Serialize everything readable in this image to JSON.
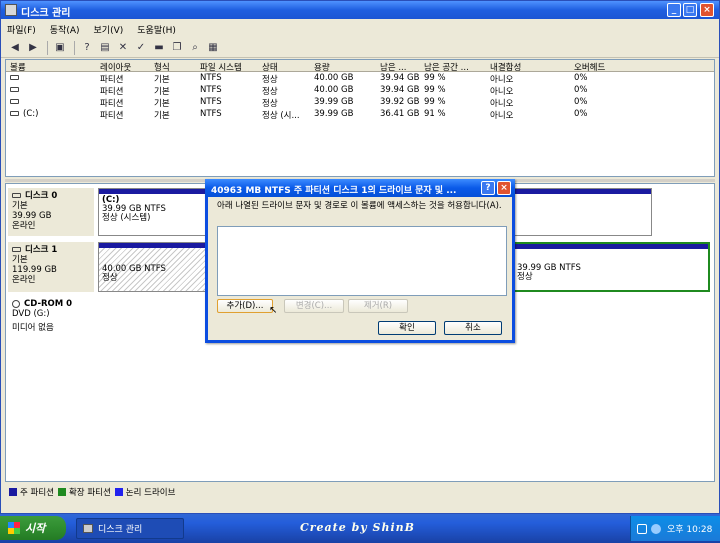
{
  "window": {
    "title": "디스크 관리",
    "min": "_",
    "max": "□",
    "close": "×"
  },
  "menu": [
    "파일(F)",
    "동작(A)",
    "보기(V)",
    "도움말(H)"
  ],
  "columns": [
    "볼륨",
    "레이아웃",
    "형식",
    "파일 시스템",
    "상태",
    "용량",
    "남은 ...",
    "남은 공간 ...",
    "내결함성",
    "오버헤드"
  ],
  "volumes": [
    [
      "",
      "파티션",
      "기본",
      "NTFS",
      "정상",
      "40.00 GB",
      "39.94 GB",
      "99 %",
      "아니오",
      "0%"
    ],
    [
      "",
      "파티션",
      "기본",
      "NTFS",
      "정상",
      "40.00 GB",
      "39.94 GB",
      "99 %",
      "아니오",
      "0%"
    ],
    [
      "",
      "파티션",
      "기본",
      "NTFS",
      "정상",
      "39.99 GB",
      "39.92 GB",
      "99 %",
      "아니오",
      "0%"
    ],
    [
      "(C:)",
      "파티션",
      "기본",
      "NTFS",
      "정상 (시...",
      "39.99 GB",
      "36.41 GB",
      "91 %",
      "아니오",
      "0%"
    ]
  ],
  "disks": {
    "disk0": {
      "name": "디스크 0",
      "type": "기본",
      "size": "39.99 GB",
      "status": "온라인",
      "part": {
        "letter": "(C:)",
        "fs": "39.99 GB NTFS",
        "state": "정상 (시스템)"
      }
    },
    "disk1": {
      "name": "디스크 1",
      "type": "기본",
      "size": "119.99 GB",
      "status": "온라인",
      "part1": {
        "fs": "40.00 GB NTFS",
        "state": "정상"
      },
      "part3": {
        "fs": "39.99 GB NTFS",
        "state": "정상"
      }
    },
    "cdrom": {
      "name": "CD-ROM 0",
      "type": "DVD (G:)",
      "media": "미디어 없음"
    }
  },
  "legend": [
    {
      "label": "주 파티션",
      "color": "#1a1aa0"
    },
    {
      "label": "확장 파티션",
      "color": "#1f8a1f"
    },
    {
      "label": "논리 드라이브",
      "color": "#2222ee"
    }
  ],
  "dialog": {
    "title": "40963 MB NTFS 주 파티션 디스크 1의 드라이브 문자 및 ...",
    "help": "?",
    "close": "×",
    "message": "아래 나열된 드라이브 문자 및 경로로 이 볼륨에 액세스하는 것을 허용합니다(A).",
    "add": "추가(D)...",
    "change": "변경(C)...",
    "remove": "제거(R)",
    "ok": "확인",
    "cancel": "취소"
  },
  "taskbar": {
    "start": "시작",
    "task": "디스크 관리",
    "brand": "Create by ShinB",
    "time": "오후 10:28"
  }
}
